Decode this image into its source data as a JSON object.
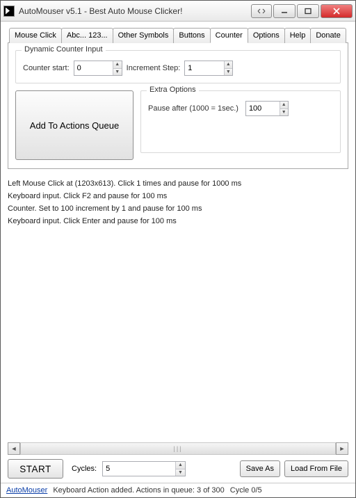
{
  "window": {
    "title": "AutoMouser v5.1 - Best Auto Mouse Clicker!"
  },
  "tabs": {
    "items": [
      {
        "label": "Mouse Click"
      },
      {
        "label": "Abc... 123..."
      },
      {
        "label": "Other Symbols"
      },
      {
        "label": "Buttons"
      },
      {
        "label": "Counter"
      },
      {
        "label": "Options"
      },
      {
        "label": "Help"
      },
      {
        "label": "Donate"
      }
    ],
    "active_index": 4
  },
  "counter_panel": {
    "dynamic_group_title": "Dynamic Counter Input",
    "counter_start_label": "Counter start:",
    "counter_start_value": "0",
    "increment_label": "Increment Step:",
    "increment_value": "1",
    "add_button_label": "Add To Actions Queue",
    "extra_group_title": "Extra Options",
    "pause_label": "Pause after (1000 = 1sec.)",
    "pause_value": "100"
  },
  "actions": [
    "Left Mouse Click at  (1203x613). Click 1 times and pause for 1000 ms",
    "Keyboard input. Click F2 and pause for 100 ms",
    "Counter. Set to 100 increment by 1 and pause for 100 ms",
    "Keyboard input. Click Enter and pause for 100 ms"
  ],
  "bottom": {
    "start_label": "START",
    "cycles_label": "Cycles:",
    "cycles_value": "5",
    "save_label": "Save As",
    "load_label": "Load From File"
  },
  "status": {
    "link": "AutoMouser",
    "message": "Keyboard Action added. Actions in queue: 3 of 300",
    "cycle": "Cycle 0/5"
  }
}
